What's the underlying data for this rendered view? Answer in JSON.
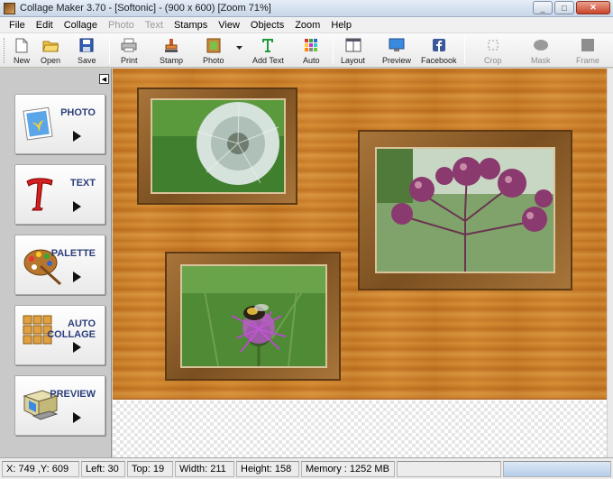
{
  "window": {
    "title": "Collage Maker 3.70 - [Softonic] - (900 x 600)  [Zoom 71%]",
    "minimize": "_",
    "maximize": "□",
    "close": "✕"
  },
  "menu": [
    "File",
    "Edit",
    "Collage",
    "Photo",
    "Text",
    "Stamps",
    "View",
    "Objects",
    "Zoom",
    "Help"
  ],
  "toolbar": {
    "new": "New",
    "open": "Open",
    "save": "Save",
    "print": "Print",
    "stamp": "Stamp",
    "photo": "Photo",
    "add_text": "Add Text",
    "auto": "Auto",
    "layout": "Layout",
    "preview": "Preview",
    "facebook": "Facebook",
    "crop": "Crop",
    "mask": "Mask",
    "frame": "Frame"
  },
  "sidebar": {
    "photo": "PHOTO",
    "text": "TEXT",
    "palette": "PALETTE",
    "auto_collage_1": "AUTO",
    "auto_collage_2": "COLLAGE",
    "preview": "PREVIEW"
  },
  "canvas": {
    "photos": [
      "dandelion",
      "purple-flowers",
      "thistle-with-bee"
    ]
  },
  "status": {
    "coords": "X: 749 ,Y: 609",
    "left": "Left: 30",
    "top": "Top: 19",
    "width": "Width: 211",
    "height": "Height: 158",
    "memory": "Memory : 1252 MB"
  }
}
